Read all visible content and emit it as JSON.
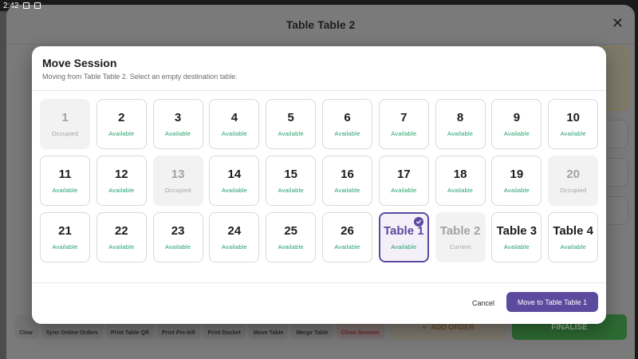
{
  "status_bar": {
    "time": "2:42"
  },
  "background": {
    "title": "Table Table 2",
    "close_glyph": "✕",
    "bottom_buttons": [
      "Clear",
      "Sync Online Orders",
      "Print Table QR",
      "Print Pre-bill",
      "Print Docket",
      "Move Table",
      "Merge Table",
      "Close Session"
    ],
    "add_order": "ADD ORDER",
    "finalise": "FINALISE"
  },
  "modal": {
    "title": "Move Session",
    "subtitle": "Moving from Table Table 2. Select an empty destination table.",
    "tables": [
      {
        "label": "1",
        "status": "Occupied",
        "state": "occupied"
      },
      {
        "label": "2",
        "status": "Available",
        "state": "available"
      },
      {
        "label": "3",
        "status": "Available",
        "state": "available"
      },
      {
        "label": "4",
        "status": "Available",
        "state": "available"
      },
      {
        "label": "5",
        "status": "Available",
        "state": "available"
      },
      {
        "label": "6",
        "status": "Available",
        "state": "available"
      },
      {
        "label": "7",
        "status": "Available",
        "state": "available"
      },
      {
        "label": "8",
        "status": "Available",
        "state": "available"
      },
      {
        "label": "9",
        "status": "Available",
        "state": "available"
      },
      {
        "label": "10",
        "status": "Available",
        "state": "available"
      },
      {
        "label": "11",
        "status": "Available",
        "state": "available"
      },
      {
        "label": "12",
        "status": "Available",
        "state": "available"
      },
      {
        "label": "13",
        "status": "Occupied",
        "state": "occupied"
      },
      {
        "label": "14",
        "status": "Available",
        "state": "available"
      },
      {
        "label": "15",
        "status": "Available",
        "state": "available"
      },
      {
        "label": "16",
        "status": "Available",
        "state": "available"
      },
      {
        "label": "17",
        "status": "Available",
        "state": "available"
      },
      {
        "label": "18",
        "status": "Available",
        "state": "available"
      },
      {
        "label": "19",
        "status": "Available",
        "state": "available"
      },
      {
        "label": "20",
        "status": "Occupied",
        "state": "occupied"
      },
      {
        "label": "21",
        "status": "Available",
        "state": "available"
      },
      {
        "label": "22",
        "status": "Available",
        "state": "available"
      },
      {
        "label": "23",
        "status": "Available",
        "state": "available"
      },
      {
        "label": "24",
        "status": "Available",
        "state": "available"
      },
      {
        "label": "25",
        "status": "Available",
        "state": "available"
      },
      {
        "label": "26",
        "status": "Available",
        "state": "available"
      },
      {
        "label": "Table 1",
        "status": "Available",
        "state": "selected"
      },
      {
        "label": "Table 2",
        "status": "Current",
        "state": "current"
      },
      {
        "label": "Table 3",
        "status": "Available",
        "state": "available"
      },
      {
        "label": "Table 4",
        "status": "Available",
        "state": "available"
      }
    ],
    "cancel_label": "Cancel",
    "confirm_label": "Move to Table Table 1"
  },
  "colors": {
    "accent": "#5b4a9e",
    "available": "#22a06b",
    "muted": "#a3a3a6"
  }
}
